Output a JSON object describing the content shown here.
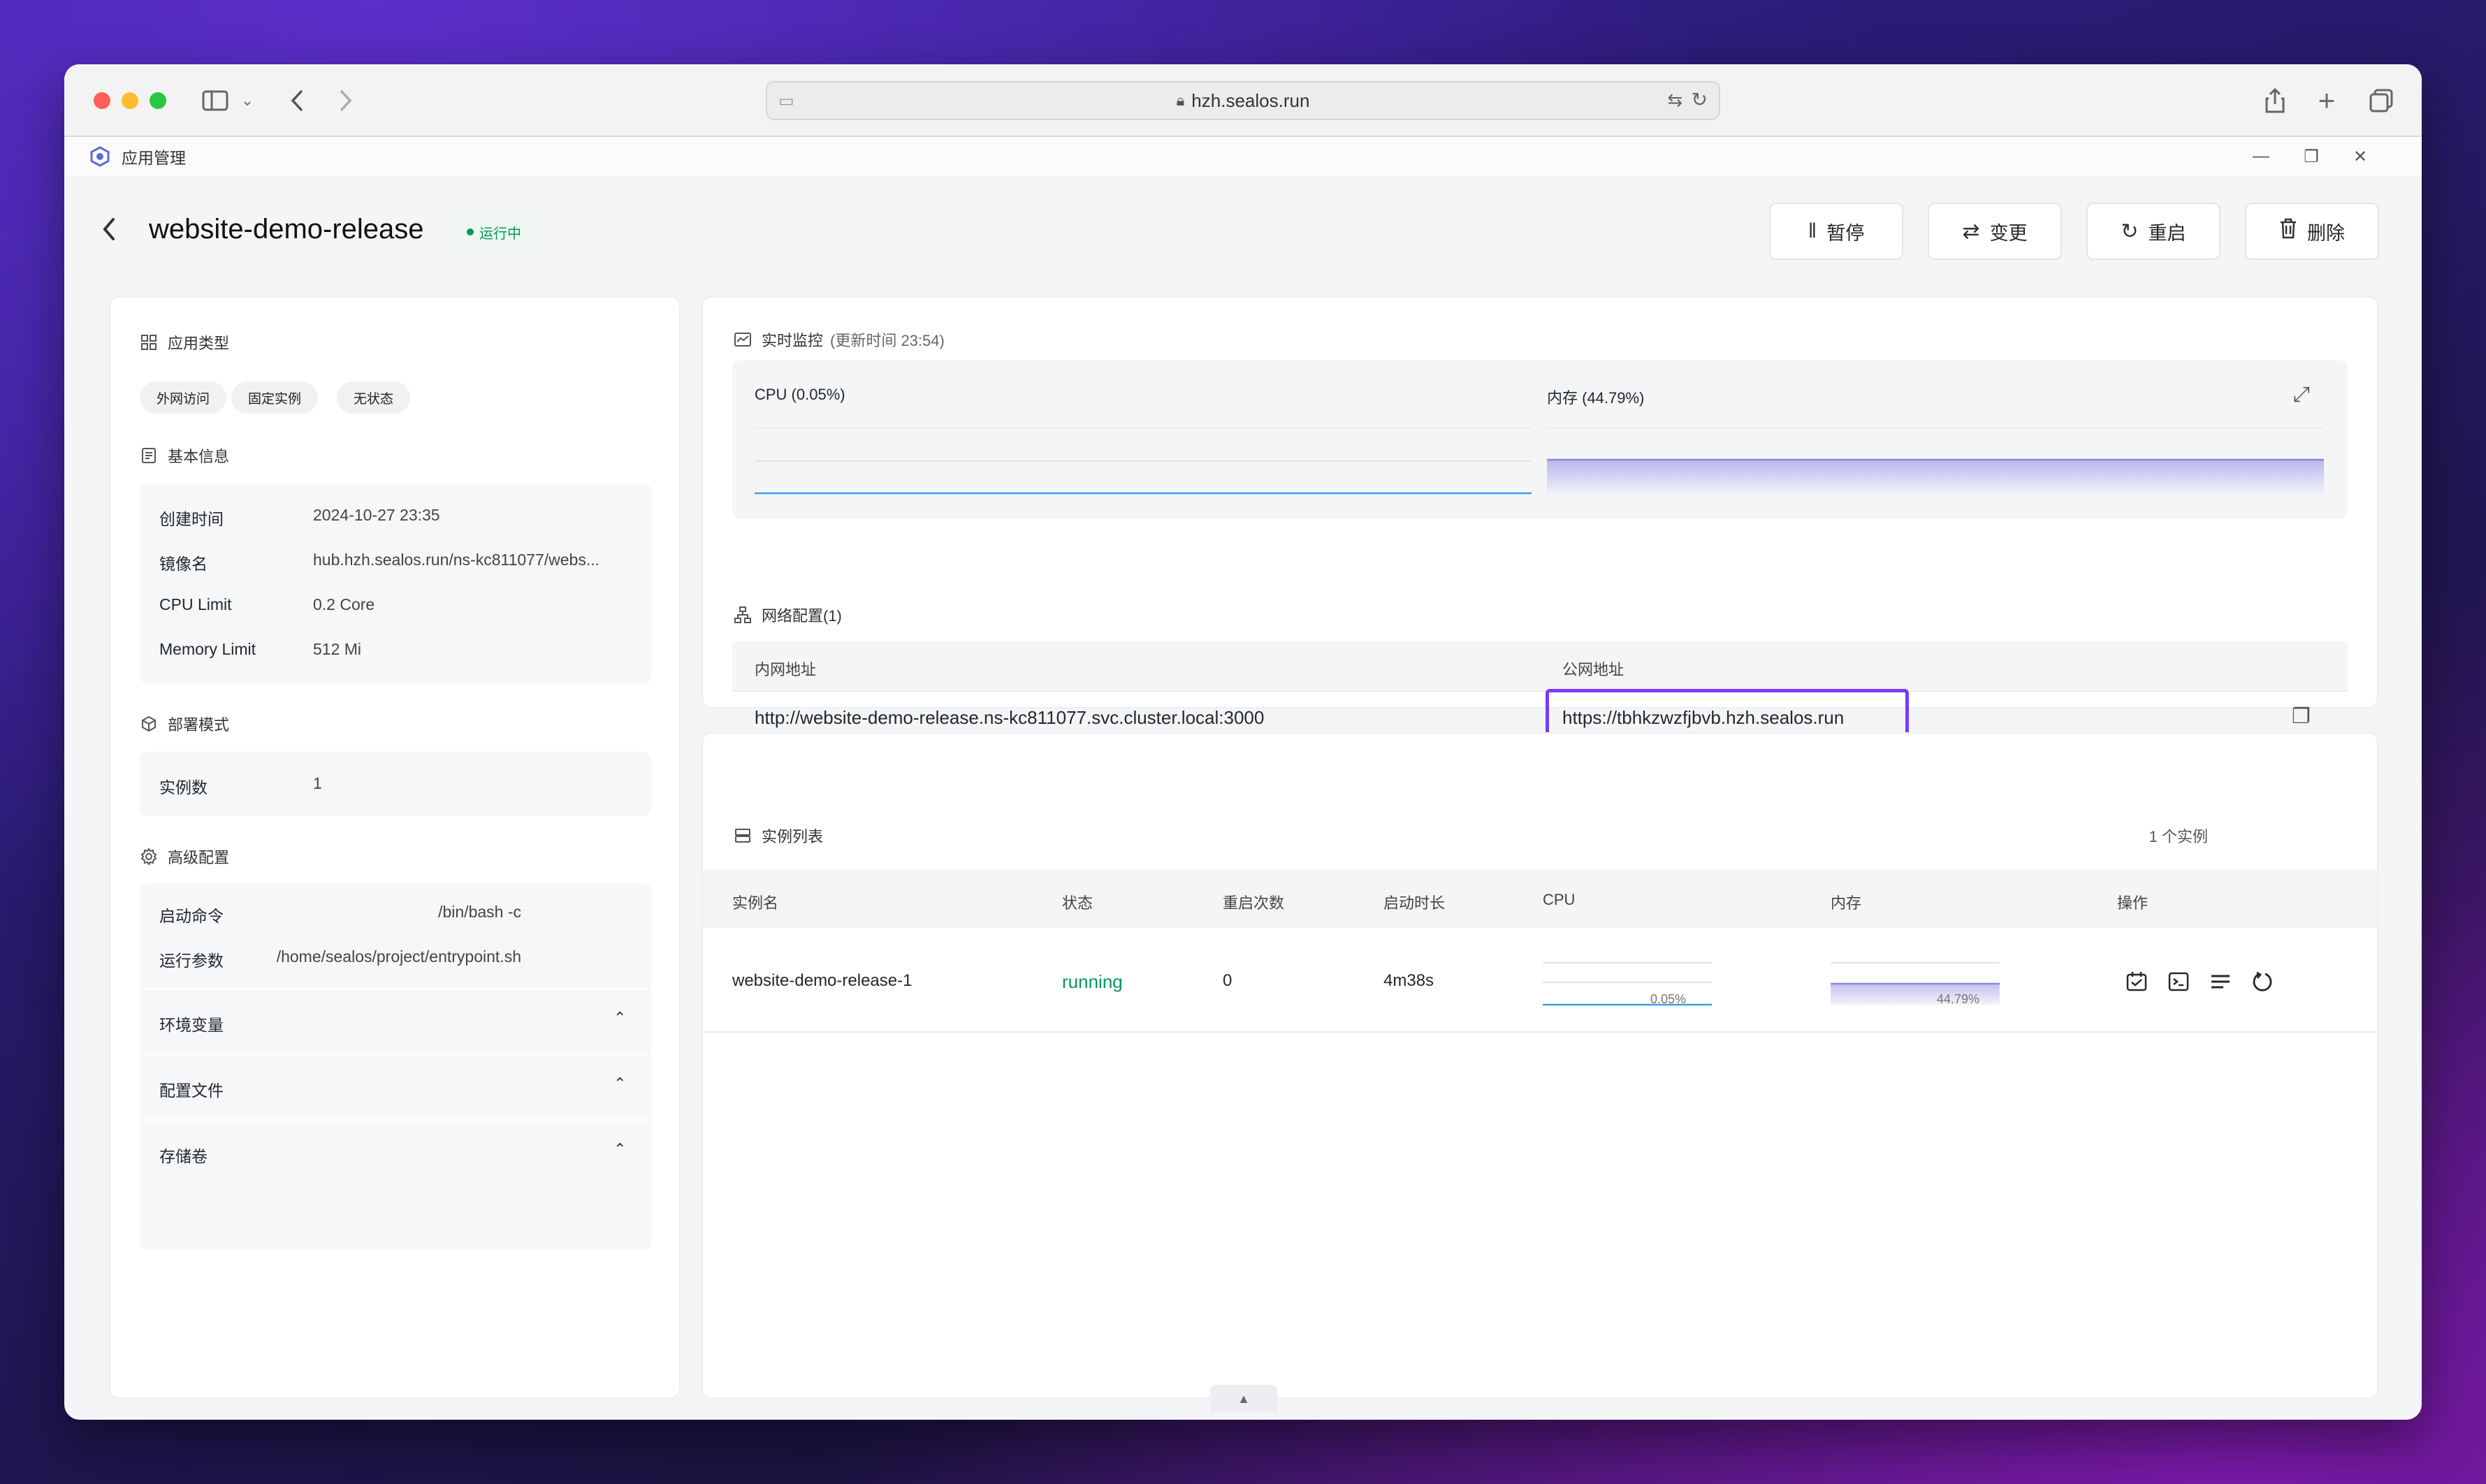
{
  "browser": {
    "url": "hzh.sealos.run"
  },
  "app": {
    "title": "应用管理",
    "name": "website-demo-release",
    "status": "运行中"
  },
  "actions": {
    "pause": "暂停",
    "change": "变更",
    "restart": "重启",
    "delete": "删除"
  },
  "sidebar": {
    "app_type_title": "应用类型",
    "tags": [
      "外网访问",
      "固定实例",
      "无状态"
    ],
    "basic_title": "基本信息",
    "basic": [
      {
        "label": "创建时间",
        "value": "2024-10-27 23:35"
      },
      {
        "label": "镜像名",
        "value": "hub.hzh.sealos.run/ns-kc811077/webs..."
      },
      {
        "label": "CPU Limit",
        "value": "0.2 Core"
      },
      {
        "label": "Memory Limit",
        "value": "512 Mi"
      }
    ],
    "deploy_title": "部署模式",
    "deploy": {
      "label": "实例数",
      "value": "1"
    },
    "advanced_title": "高级配置",
    "advanced": [
      {
        "label": "启动命令",
        "value": "/bin/bash -c"
      },
      {
        "label": "运行参数",
        "value": "/home/sealos/project/entrypoint.sh"
      }
    ],
    "collapsibles": [
      "环境变量",
      "配置文件",
      "存储卷"
    ]
  },
  "monitor": {
    "title": "实时监控",
    "updated": "(更新时间  23:54)",
    "cpu_label": "CPU  (0.05%)",
    "mem_label": "内存  (44.79%)",
    "cpu_percent": 0.05,
    "mem_percent": 44.79
  },
  "network": {
    "title": "网络配置(1)",
    "internal_header": "内网地址",
    "public_header": "公网地址",
    "internal": "http://website-demo-release.ns-kc811077.svc.cluster.local:3000",
    "public": "https://tbhkzwzfjbvb.hzh.sealos.run"
  },
  "instances": {
    "title": "实例列表",
    "count": "1 个实例",
    "columns": [
      "实例名",
      "状态",
      "重启次数",
      "启动时长",
      "CPU",
      "内存",
      "操作"
    ],
    "rows": [
      {
        "name": "website-demo-release-1",
        "status": "running",
        "restarts": "0",
        "uptime": "4m38s",
        "cpu": "0.05%",
        "mem": "44.79%"
      }
    ]
  },
  "colors": {
    "accent": "#7a3cff",
    "running": "#039855",
    "cpu_line": "#3b9ee8",
    "mem_line": "#8a86d8"
  },
  "icons": {
    "status_dot": "green-dot-icon",
    "highlight": "purple-highlight-box"
  }
}
